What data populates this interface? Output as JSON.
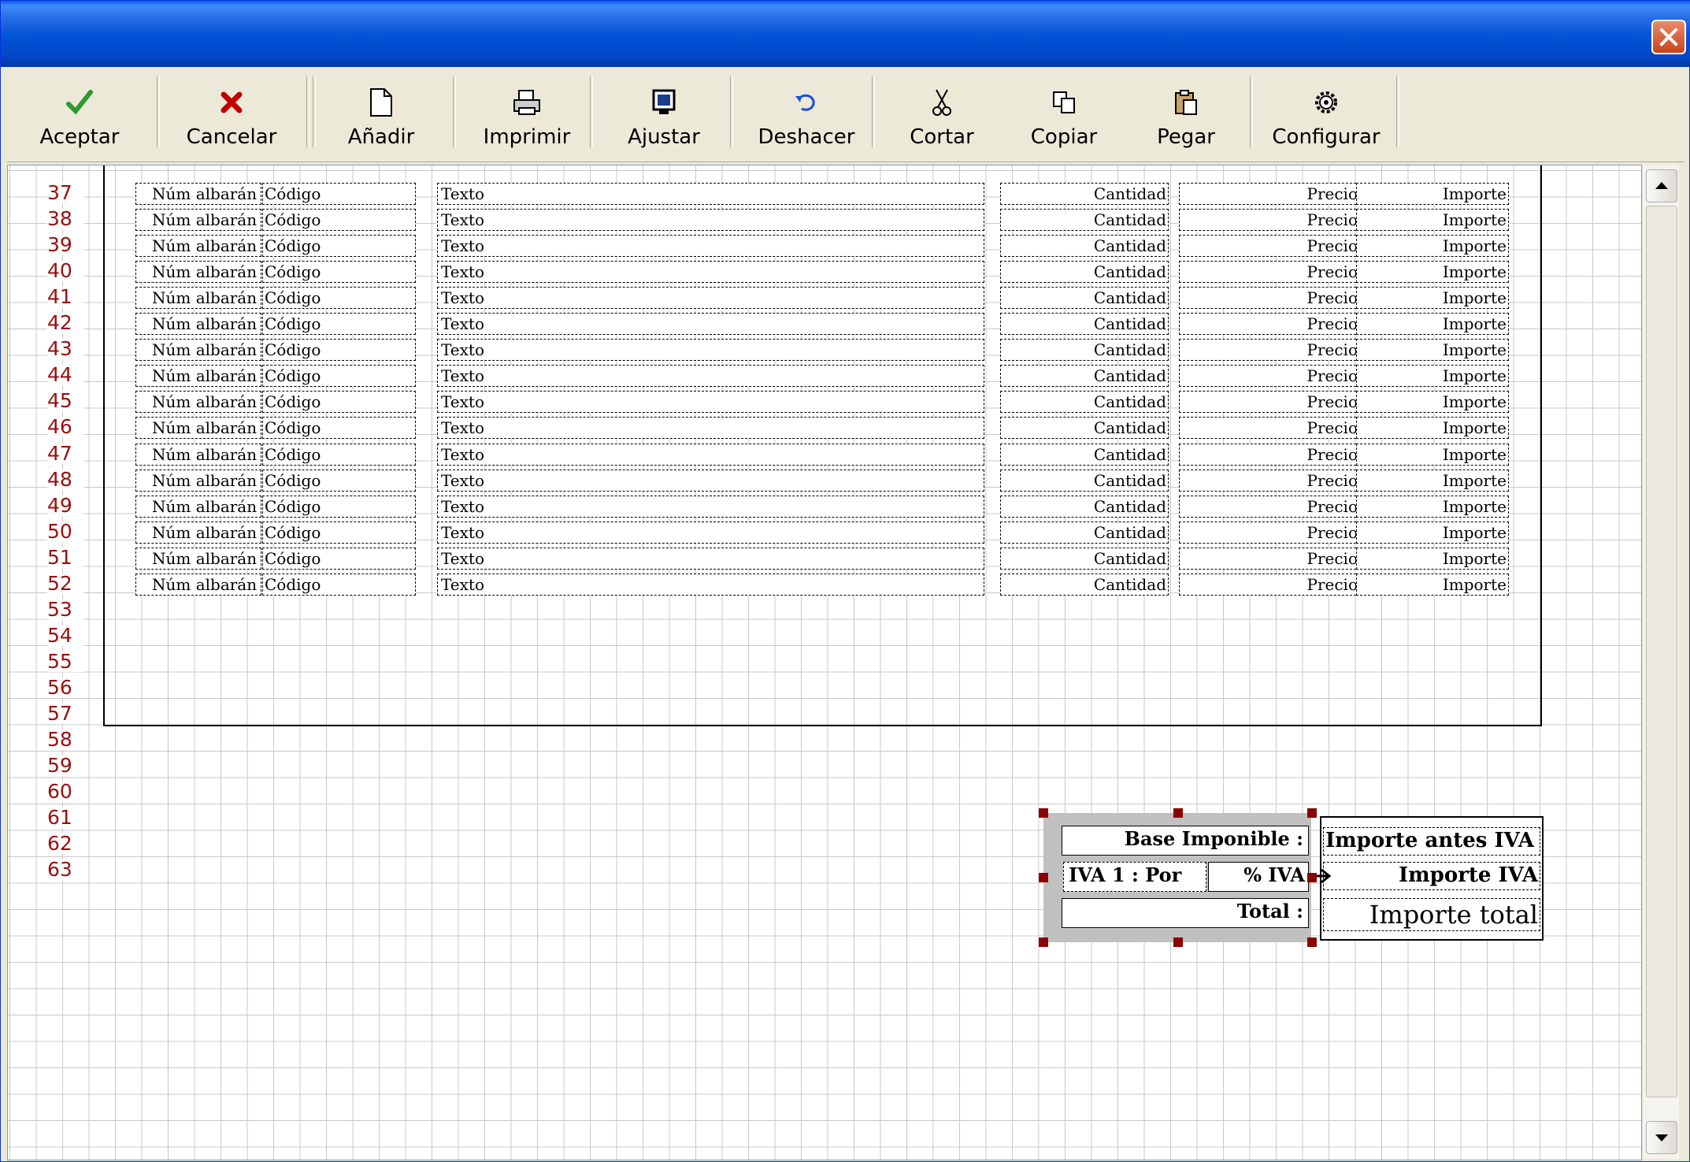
{
  "toolbar": {
    "buttons": [
      {
        "label": "Aceptar",
        "icon": "check-icon"
      },
      {
        "label": "Cancelar",
        "icon": "cancel-x-icon"
      },
      {
        "label": "Añadir",
        "icon": "new-document-icon"
      },
      {
        "label": "Imprimir",
        "icon": "printer-icon"
      },
      {
        "label": "Ajustar",
        "icon": "monitor-icon"
      },
      {
        "label": "Deshacer",
        "icon": "undo-icon"
      },
      {
        "label": "Cortar",
        "icon": "scissors-icon"
      },
      {
        "label": "Copiar",
        "icon": "copy-icon"
      },
      {
        "label": "Pegar",
        "icon": "paste-icon"
      },
      {
        "label": "Configurar",
        "icon": "gear-icon"
      }
    ]
  },
  "row_numbers": [
    "37",
    "38",
    "39",
    "40",
    "41",
    "42",
    "43",
    "44",
    "45",
    "46",
    "47",
    "48",
    "49",
    "50",
    "51",
    "52",
    "53",
    "54",
    "55",
    "56",
    "57",
    "58",
    "59",
    "60",
    "61",
    "62",
    "63"
  ],
  "detail_fields": {
    "albaran": "Núm albarán",
    "codigo": "Código",
    "texto": "Texto",
    "cantidad": "Cantidad",
    "precio": "Precio",
    "importe": "Importe"
  },
  "detail_row_count": 16,
  "totals": {
    "base_label": "Base Imponible :",
    "iva_label": "IVA 1 : Por",
    "iva_pct": "% IVA",
    "total_label": "Total :",
    "base_value": "Importe antes IVA",
    "iva_value": "Importe IVA",
    "total_value": "Importe total"
  },
  "colors": {
    "row_number": "#9b0e0e",
    "selection_handle": "#8b0000",
    "titlebar": "#0052d6",
    "accept_check": "#2e9a2e",
    "cancel_x": "#c00000",
    "undo_arrow": "#1e4fd8"
  }
}
